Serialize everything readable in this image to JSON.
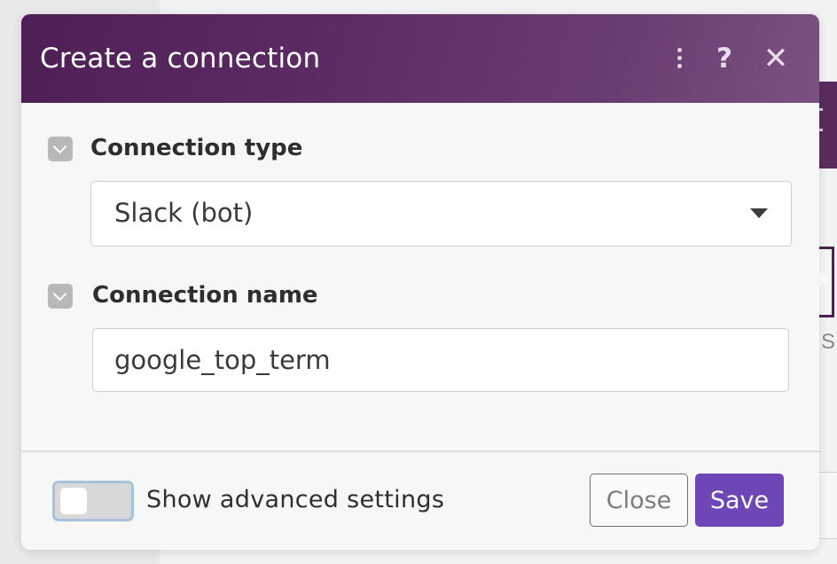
{
  "dialog": {
    "title": "Create a connection",
    "header_icons": [
      "more-vertical-icon",
      "help-icon",
      "close-icon"
    ],
    "help_glyph": "?",
    "close_glyph": "✕"
  },
  "fields": {
    "connection_type": {
      "label": "Connection type",
      "value": "Slack (bot)"
    },
    "connection_name": {
      "label": "Connection name",
      "value": "google_top_term"
    }
  },
  "footer": {
    "advanced_toggle_label": "Show advanced settings",
    "advanced_toggle_on": false,
    "close_label": "Close",
    "save_label": "Save"
  },
  "background": {
    "partial_letter": "S"
  },
  "colors": {
    "header_gradient_start": "#4e1f55",
    "header_gradient_end": "#7a5280",
    "save_button": "#6d47b6",
    "toggle_focus_ring": "#a7c2dc"
  }
}
